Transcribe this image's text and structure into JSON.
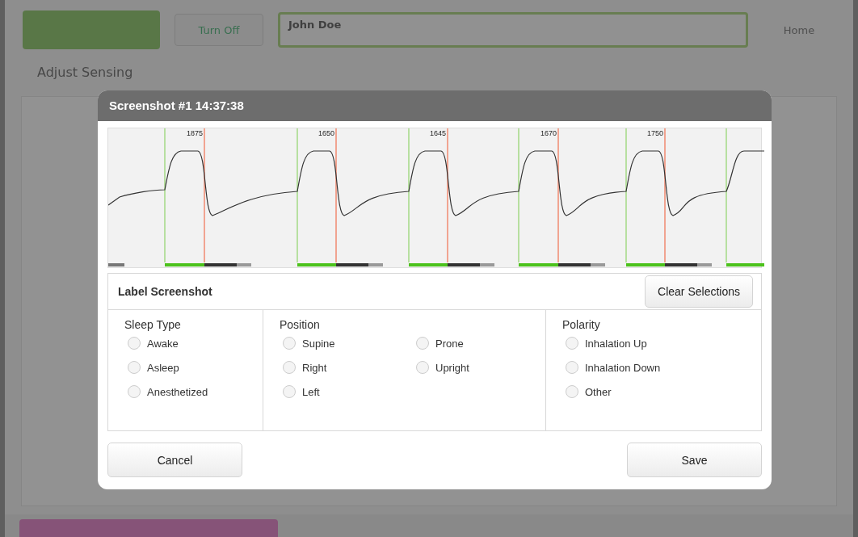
{
  "background": {
    "header_button": "Turn Off",
    "patient_name": "John Doe",
    "home": "Home",
    "section_title": "Adjust Sensing"
  },
  "dialog": {
    "title": "Screenshot #1 14:37:38",
    "waveform": {
      "markers": [
        "1875",
        "1650",
        "1645",
        "1670",
        "1750"
      ]
    },
    "label_panel": {
      "title": "Label Screenshot",
      "clear_button": "Clear Selections",
      "groups": [
        {
          "title": "Sleep Type",
          "kind": "list",
          "options": [
            {
              "label": "Awake",
              "selected": false
            },
            {
              "label": "Asleep",
              "selected": false
            },
            {
              "label": "Anesthetized",
              "selected": false
            }
          ]
        },
        {
          "title": "Position",
          "kind": "grid",
          "options": [
            {
              "label": "Supine",
              "selected": false
            },
            {
              "label": "Prone",
              "selected": false
            },
            {
              "label": "Right",
              "selected": false
            },
            {
              "label": "Upright",
              "selected": false
            },
            {
              "label": "Left",
              "selected": false
            }
          ]
        },
        {
          "title": "Polarity",
          "kind": "list",
          "options": [
            {
              "label": "Inhalation Up",
              "selected": false
            },
            {
              "label": "Inhalation Down",
              "selected": false
            },
            {
              "label": "Other",
              "selected": false
            }
          ]
        }
      ]
    },
    "buttons": [
      {
        "label": "Cancel"
      },
      {
        "label": "Save"
      }
    ]
  }
}
